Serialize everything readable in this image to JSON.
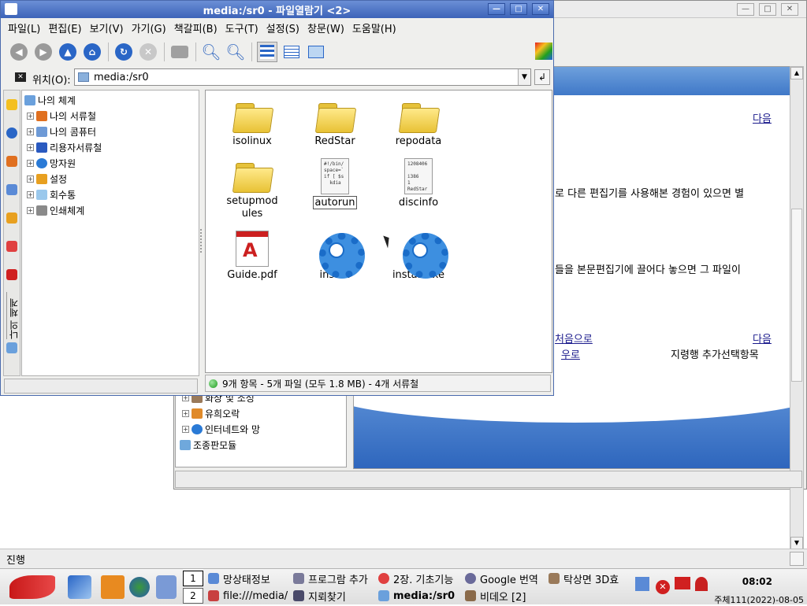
{
  "background_window": {
    "link_next_top": "다음",
    "text_line1": "로 다른 편집기를 사용해본 경험이 있으면 별",
    "text_line2": "들을 본문편집기에 끌어다 놓으면 그 파일이",
    "link_first_partial": "처음으로",
    "link_next_bottom": "다음",
    "link_up_partial": "우로",
    "text_next_item": "지령행 추가선택항목",
    "tree_items": [
      {
        "label": "화상 및 소성"
      },
      {
        "label": "유희오락"
      },
      {
        "label": "인터네트와 망"
      },
      {
        "label": "조종판모듈"
      }
    ]
  },
  "main_window": {
    "title": "media:/sr0 - 파일열람기 <2>",
    "title_buttons": {
      "minimize": "—",
      "maximize": "□",
      "close": "✕"
    },
    "menu": [
      "파일(L)",
      "편집(E)",
      "보기(V)",
      "가기(G)",
      "책갈피(B)",
      "도구(T)",
      "설정(S)",
      "창문(W)",
      "도움말(H)"
    ],
    "location_label": "위치(O):",
    "location_value": "media:/sr0",
    "tree": [
      {
        "label": "나의 체계",
        "expander": ""
      },
      {
        "label": "나의 서류철",
        "expander": "+"
      },
      {
        "label": "나의 콤퓨터",
        "expander": "+"
      },
      {
        "label": "리용자서류철",
        "expander": "+"
      },
      {
        "label": "망자원",
        "expander": "+"
      },
      {
        "label": "설정",
        "expander": "+"
      },
      {
        "label": "회수통",
        "expander": "+"
      },
      {
        "label": "인쇄체계",
        "expander": "+"
      }
    ],
    "sidebar_vertical_label": "나의 체계",
    "files": [
      {
        "name": "isolinux",
        "kind": "folder"
      },
      {
        "name": "RedStar",
        "kind": "folder"
      },
      {
        "name": "repodata",
        "kind": "folder"
      },
      {
        "name": "setupmodules",
        "kind": "folder"
      },
      {
        "name": "autorun",
        "kind": "script",
        "thumb": "#!/bin/\nspace=`\nif [ $s\n  kdia"
      },
      {
        "name": "discinfo",
        "kind": "text",
        "thumb": "1208406\n\ni386\n1\nRedStar"
      },
      {
        "name": "Guide.pdf",
        "kind": "pdf"
      },
      {
        "name": "install",
        "kind": "exec"
      },
      {
        "name": "install.exe",
        "kind": "exec"
      }
    ],
    "status": "9개 항목 - 5개 파일 (모두 1.8 MB) - 4개 서류철"
  },
  "bottom_status": "진행",
  "taskbar": {
    "pagers": [
      "1",
      "2"
    ],
    "tasks_row1": [
      "망상태정보",
      "프로그람 추가",
      "2장. 기초기능",
      "Google 번역",
      "탁상면 3D효"
    ],
    "tasks_row2": [
      "file:///media/",
      "지뢰찾기",
      "media:/sr0",
      "비데오 [2]"
    ],
    "clock_time": "08:02",
    "clock_date": "주체111(2022)-08-05"
  },
  "colors": {
    "titlebar": "#3c63b8",
    "folder": "#f2d35a",
    "gear": "#1a6cc8",
    "link": "#1a1a8c",
    "blue_band": "#3f78c8"
  }
}
